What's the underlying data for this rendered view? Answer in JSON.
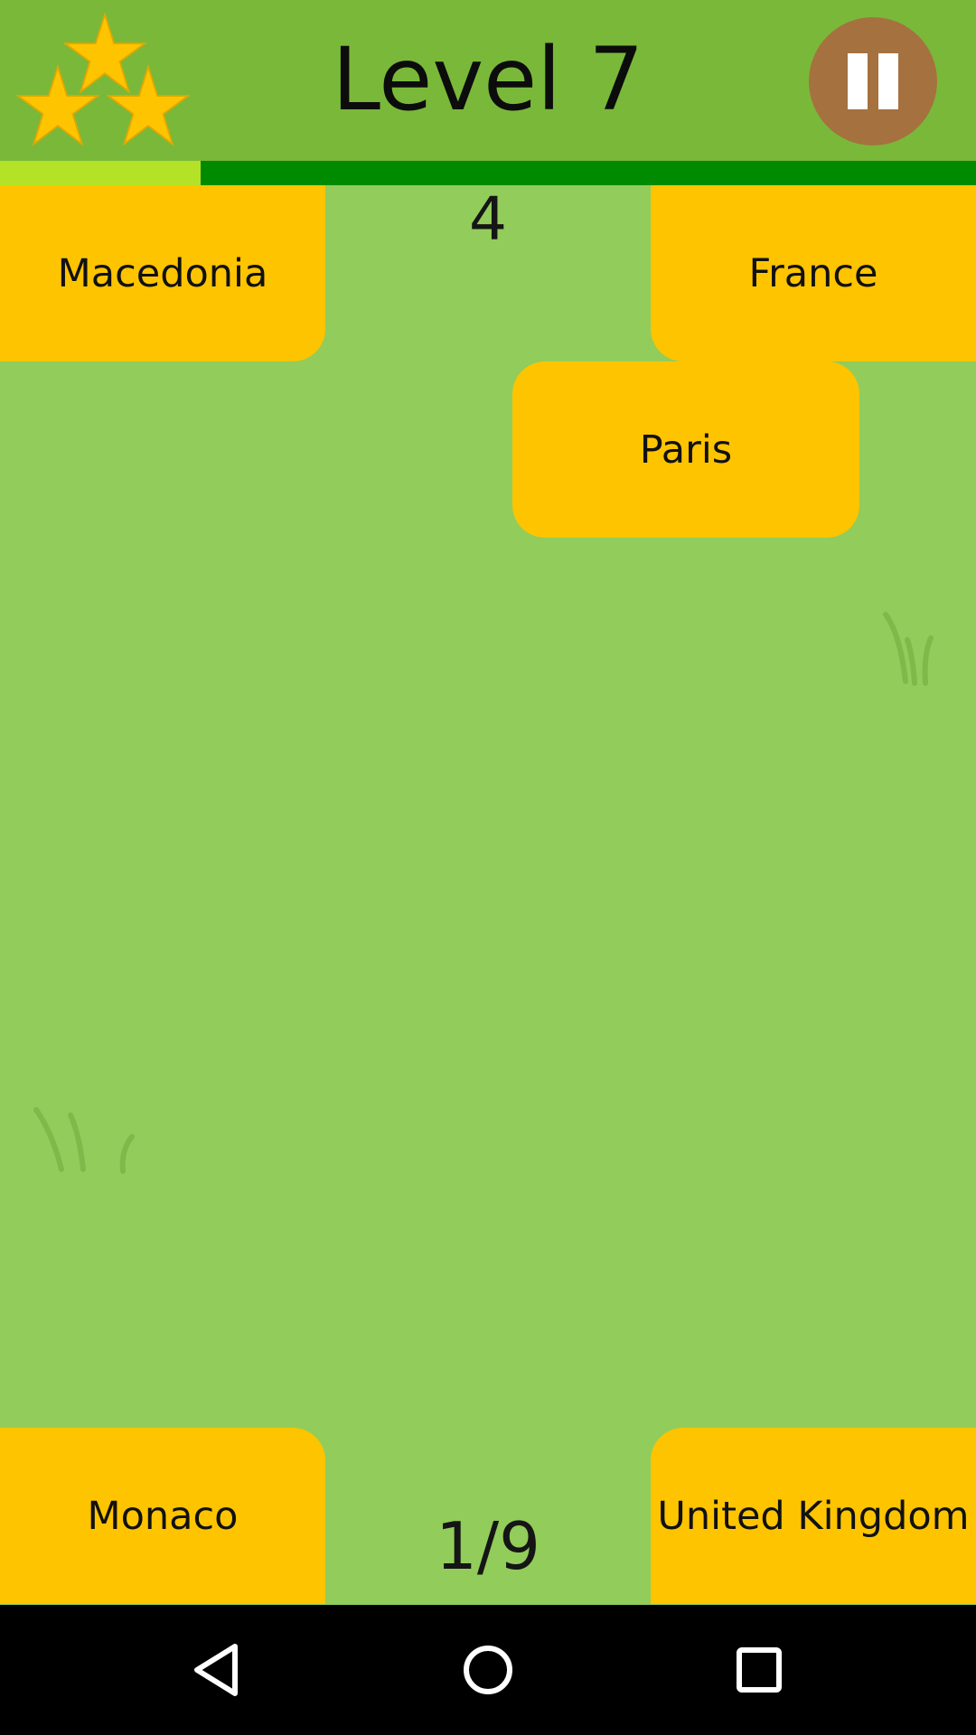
{
  "header": {
    "level_title": "Level 7",
    "stars_earned": 3,
    "star_icons": [
      "star-icon",
      "star-icon",
      "star-icon"
    ],
    "pause_icon": "pause-icon"
  },
  "progress": {
    "fraction": 0.206
  },
  "timer": "4",
  "cards": {
    "top_left": "Macedonia",
    "top_right": "France",
    "moving": "Paris",
    "bottom_left": "Monaco",
    "bottom_right": "United Kingdom"
  },
  "question_counter": "1/9",
  "navbar": {
    "back_icon": "back-triangle-icon",
    "home_icon": "home-circle-icon",
    "recents_icon": "recents-square-icon"
  },
  "colors": {
    "background": "#92cc5a",
    "header": "#7ab83a",
    "card": "#ffc400",
    "pause_button": "#a5713f",
    "progress_track": "#008a00",
    "progress_fill": "#b4e226",
    "star": "#ffc400",
    "navbar": "#000000"
  }
}
